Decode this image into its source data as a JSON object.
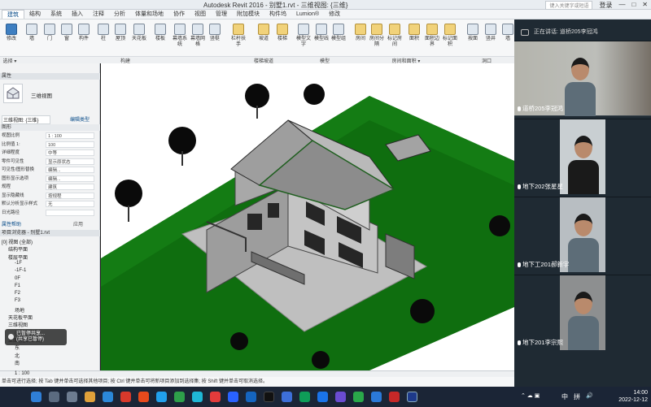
{
  "app": {
    "title": "Autodesk Revit 2016 -    别墅1.rvt - 三维视图: {三维}",
    "search_placeholder": "键入关键字或短语",
    "login": "登录"
  },
  "menubar": {
    "tabs": [
      "建筑",
      "结构",
      "系统",
      "插入",
      "注释",
      "分析",
      "体量和场地",
      "协作",
      "视图",
      "管理",
      "附加模块",
      "构件坞",
      "Lumion®",
      "修改"
    ]
  },
  "ribbon": {
    "buttons": [
      {
        "label": "修改",
        "icon": "select-arrow-icon"
      },
      {
        "label": "墙",
        "icon": "wall-icon"
      },
      {
        "label": "门",
        "icon": "door-icon"
      },
      {
        "label": "窗",
        "icon": "window-icon"
      },
      {
        "label": "构件",
        "icon": "component-icon"
      },
      {
        "label": "柱",
        "icon": "column-icon"
      },
      {
        "label": "屋顶",
        "icon": "roof-icon"
      },
      {
        "label": "天花板",
        "icon": "ceiling-icon"
      },
      {
        "label": "楼板",
        "icon": "floor-icon"
      },
      {
        "label": "幕墙系统",
        "icon": "curtain-system-icon"
      },
      {
        "label": "幕墙网格",
        "icon": "curtain-grid-icon"
      },
      {
        "label": "竖梃",
        "icon": "mullion-icon"
      },
      {
        "label": "栏杆扶手",
        "icon": "railing-icon"
      },
      {
        "label": "坡道",
        "icon": "ramp-icon"
      },
      {
        "label": "楼梯",
        "icon": "stair-icon"
      },
      {
        "label": "模型文字",
        "icon": "model-text-icon"
      },
      {
        "label": "模型线",
        "icon": "model-line-icon"
      },
      {
        "label": "模型组",
        "icon": "model-group-icon"
      },
      {
        "label": "房间",
        "icon": "room-icon"
      },
      {
        "label": "房间分隔",
        "icon": "room-separator-icon"
      },
      {
        "label": "标记房间",
        "icon": "tag-room-icon"
      },
      {
        "label": "面积",
        "icon": "area-icon"
      },
      {
        "label": "面积边界",
        "icon": "area-boundary-icon"
      },
      {
        "label": "标记面积",
        "icon": "tag-area-icon"
      },
      {
        "label": "按面",
        "icon": "by-face-icon"
      },
      {
        "label": "竖井",
        "icon": "shaft-icon"
      },
      {
        "label": "墙",
        "icon": "opening-wall-icon"
      }
    ],
    "groups": [
      "选择 ▾",
      "构建",
      "楼梯坡道",
      "模型",
      "房间和面积 ▾",
      "洞口"
    ]
  },
  "properties": {
    "header": "属性",
    "type_name": "三维视图",
    "selector": "三维视图: {三维}",
    "edit_type": "编辑类型",
    "section": "图形",
    "rows": [
      {
        "k": "视图比例",
        "v": "1 : 100"
      },
      {
        "k": "比例值 1:",
        "v": "100"
      },
      {
        "k": "详细程度",
        "v": "中等"
      },
      {
        "k": "零件可见性",
        "v": "显示原状态"
      },
      {
        "k": "可见性/图形替换",
        "v": "编辑..."
      },
      {
        "k": "图形显示选项",
        "v": "编辑..."
      },
      {
        "k": "规程",
        "v": "建筑"
      },
      {
        "k": "显示隐藏线",
        "v": "按规程"
      },
      {
        "k": "默认分析显示样式",
        "v": "无"
      },
      {
        "k": "日光路径",
        "v": ""
      }
    ],
    "help": "属性帮助",
    "apply": "应用"
  },
  "browser": {
    "header": "项目浏览器 - 别墅1.rvt",
    "items": [
      "[0] 视图 (全部)",
      "结构平面",
      "楼层平面",
      "-1F",
      "-1F-1",
      "0F",
      "F1",
      "F2",
      "F3",
      "场地",
      "天花板平面",
      "三维视图",
      "{三维}",
      "立面 (建筑立面)",
      "东",
      "北",
      "南"
    ]
  },
  "notification": {
    "line1": "已暂停共享...",
    "line2": "(共享已暂停)"
  },
  "statusbar": {
    "scale": "1 : 100",
    "text": "单击可进行选择; 按 Tab 键并单击可选择其他项目; 按 Ctrl 键并单击可将新项目添加到选择集; 按 Shift 键并单击可取消选择。"
  },
  "meeting": {
    "header": "正在讲话: 道桥205李冠鸿",
    "participants": [
      {
        "name": "道桥205李冠鸿"
      },
      {
        "name": "地下202张星星"
      },
      {
        "name": "地下工201郝新宇"
      },
      {
        "name": "地下201李宗熙"
      }
    ]
  },
  "taskbar": {
    "time": "14:00",
    "date": "2022-12-12",
    "lang": "中",
    "ime": "拼"
  }
}
